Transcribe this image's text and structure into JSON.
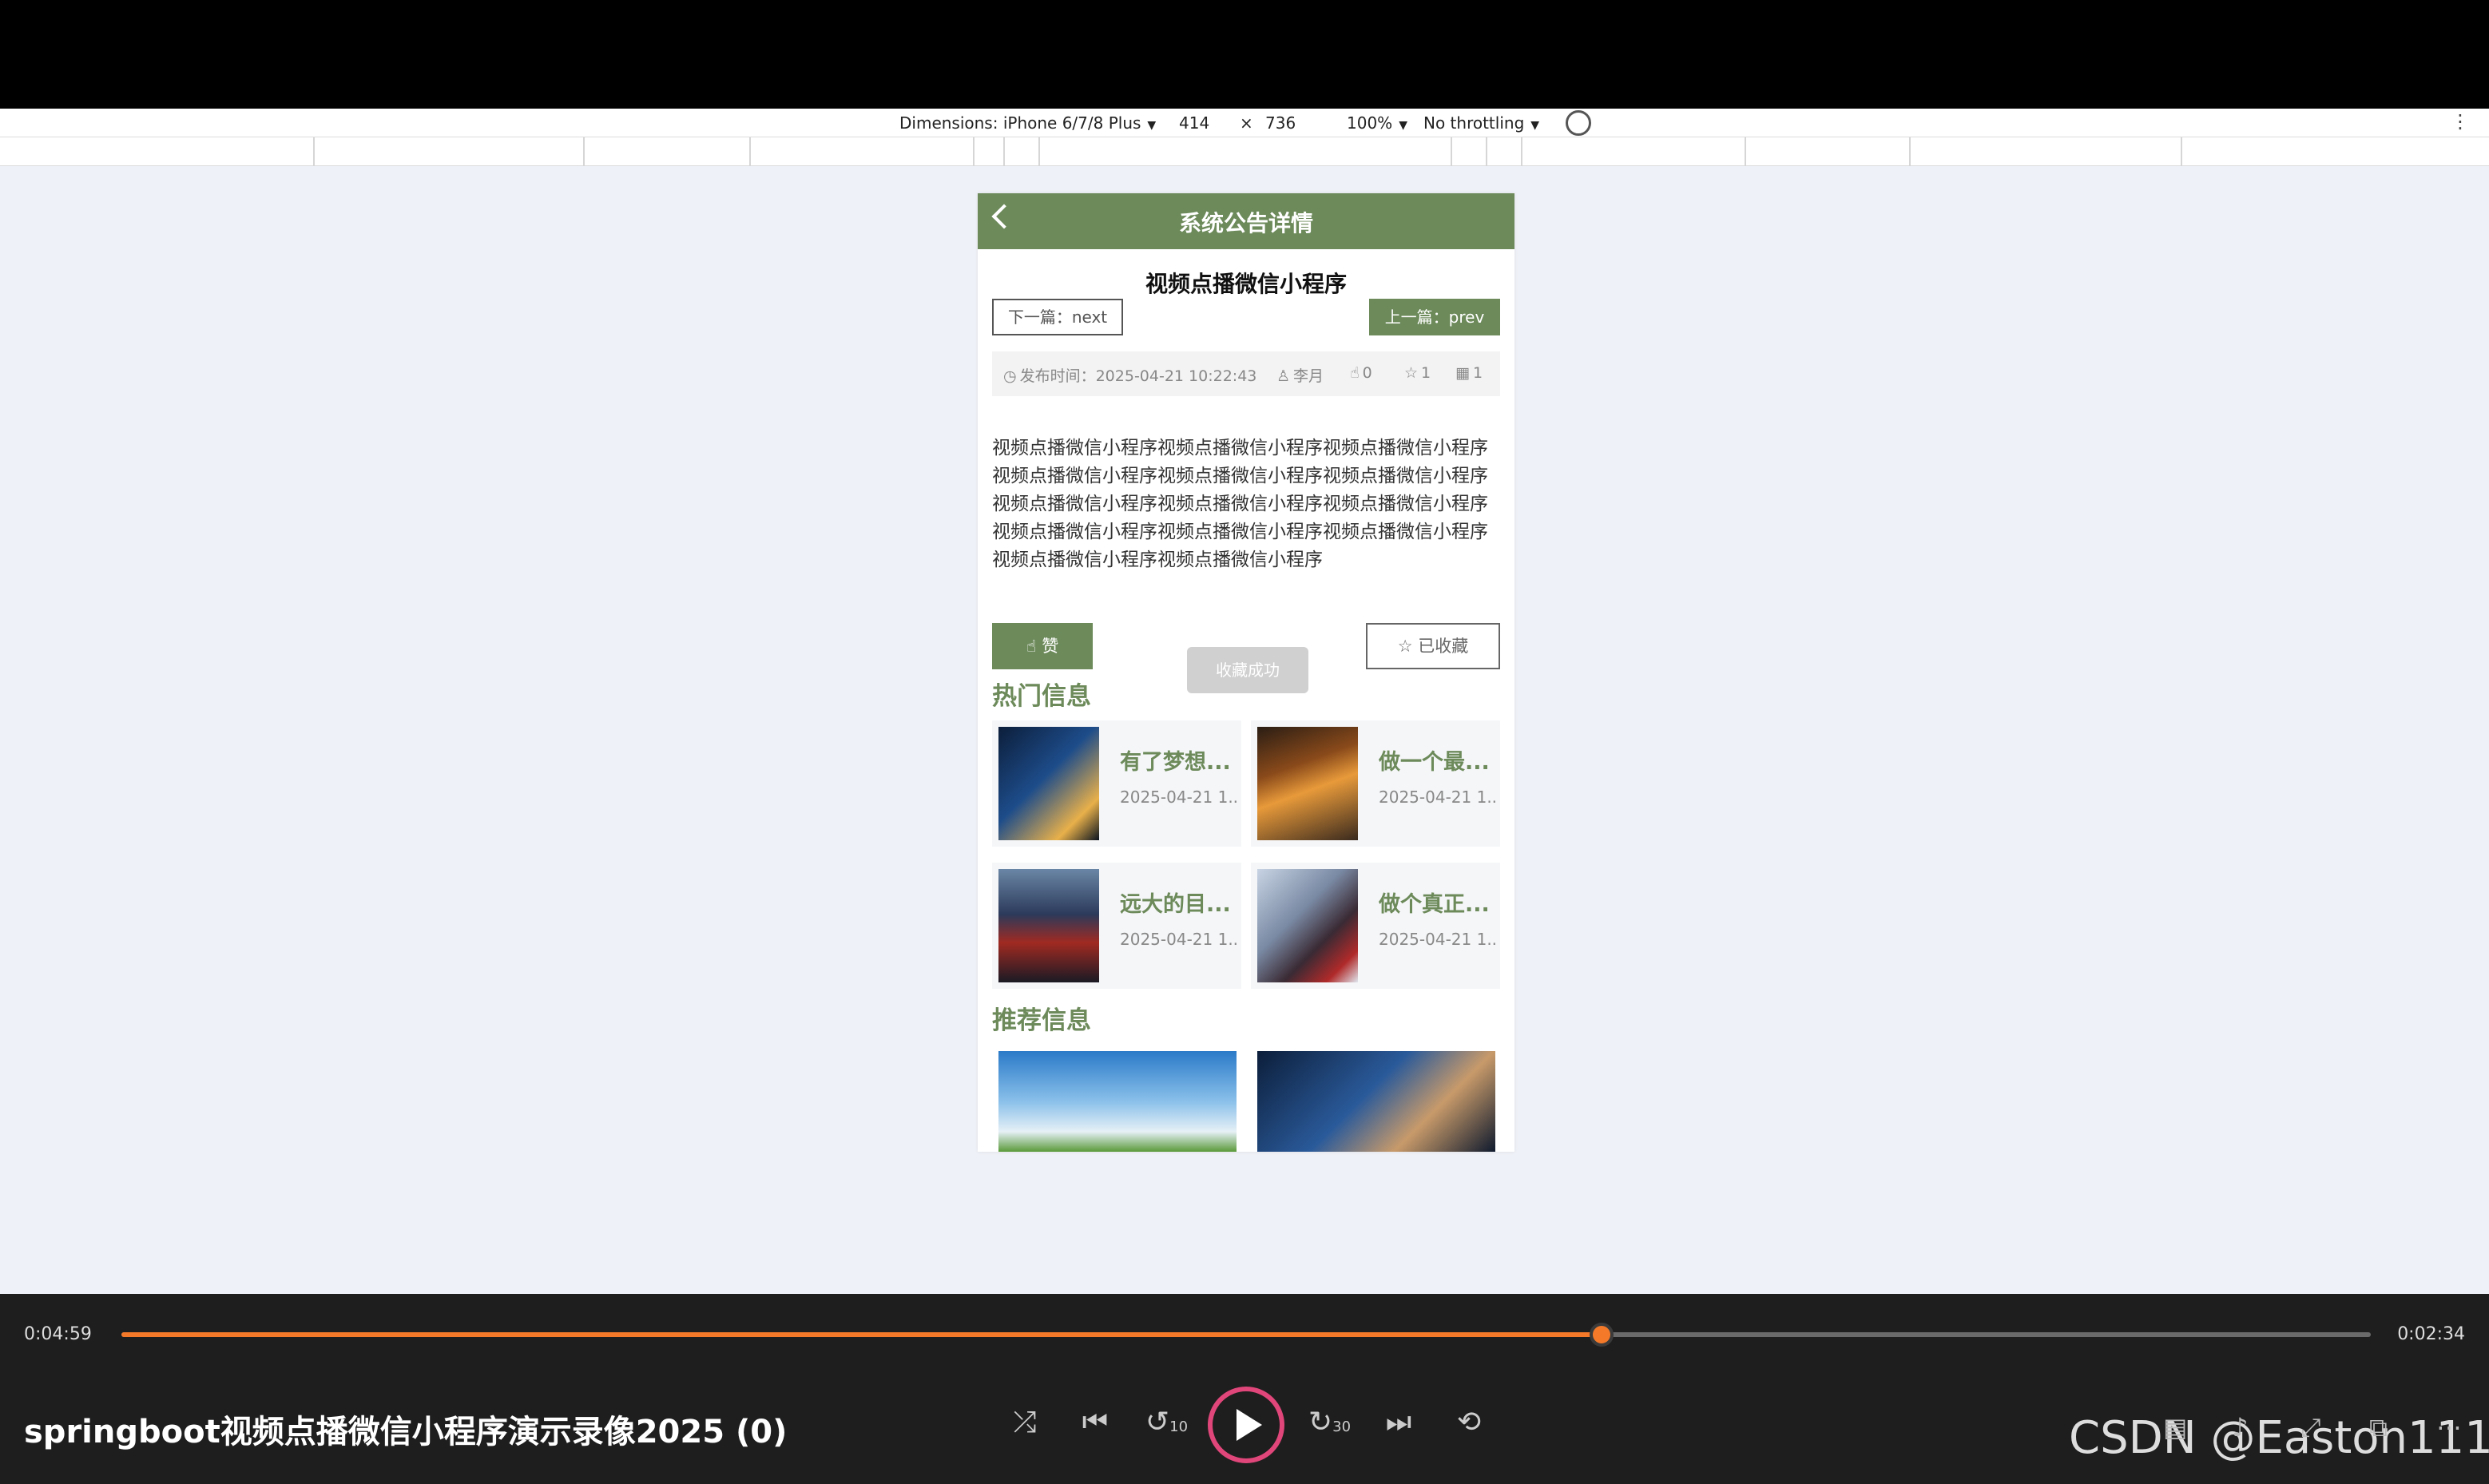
{
  "devtools": {
    "dimensions_label": "Dimensions: iPhone 6/7/8 Plus",
    "width": "414",
    "times": "×",
    "height": "736",
    "zoom": "100%",
    "throttling": "No throttling",
    "more": "⋮",
    "caret": "▼"
  },
  "phone": {
    "page_title": "系统公告详情",
    "article_title": "视频点播微信小程序",
    "next_label": "下一篇：next",
    "prev_label": "上一篇：prev",
    "meta": {
      "publish_time": "发布时间：2025-04-21 10:22:43",
      "author": "李月",
      "likes": "0",
      "favorites": "1",
      "views": "1"
    },
    "body": "视频点播微信小程序视频点播微信小程序视频点播微信小程序视频点播微信小程序视频点播微信小程序视频点播微信小程序视频点播微信小程序视频点播微信小程序视频点播微信小程序视频点播微信小程序视频点播微信小程序视频点播微信小程序视频点播微信小程序视频点播微信小程序",
    "like_label": "赞",
    "toast": "收藏成功",
    "fav_label": "已收藏",
    "hot_title": "热门信息",
    "rec_title": "推荐信息",
    "hot_items": [
      {
        "title": "有了梦想...",
        "date": "2025-04-21 1..."
      },
      {
        "title": "做一个最...",
        "date": "2025-04-21 1..."
      },
      {
        "title": "远大的目...",
        "date": "2025-04-21 1..."
      },
      {
        "title": "做个真正...",
        "date": "2025-04-21 1..."
      }
    ]
  },
  "player": {
    "current_time": "0:04:59",
    "total_time": "0:02:34",
    "progress": 0.658,
    "title": "springboot视频点播微信小程序演示录像2025 (0)",
    "watermark": "CSDN @Easton111",
    "accent": "#f47a2a",
    "skip_back": "10",
    "skip_forward": "30"
  }
}
